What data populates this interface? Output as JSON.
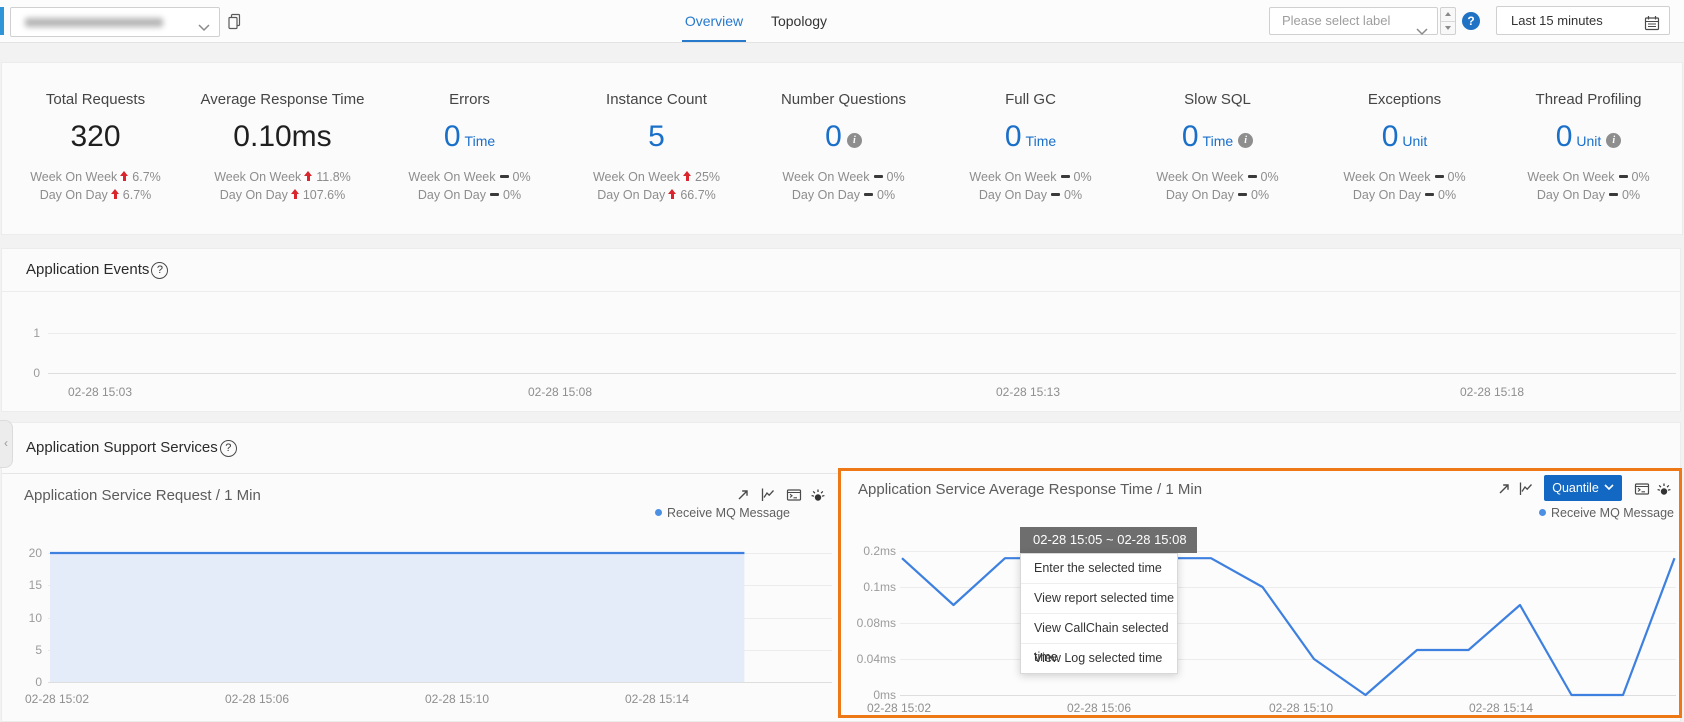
{
  "topbar": {
    "tabs": [
      {
        "label": "Overview"
      },
      {
        "label": "Topology"
      }
    ],
    "label_select_placeholder": "Please select label",
    "help_label": "?",
    "time_range": "Last 15 minutes"
  },
  "metrics": {
    "wow_label": "Week On Week",
    "dod_label": "Day On Day",
    "cards": [
      {
        "title": "Total Requests",
        "value": "320",
        "unit": "",
        "wow_trend": "up",
        "wow": "6.7%",
        "dod_trend": "up",
        "dod": "6.7%"
      },
      {
        "title": "Average Response Time",
        "value": "0.10ms",
        "unit": "",
        "wow_trend": "up",
        "wow": "11.8%",
        "dod_trend": "up",
        "dod": "107.6%"
      },
      {
        "title": "Errors",
        "value": "0",
        "unit": "Time",
        "wow_trend": "flat",
        "wow": "0%",
        "dod_trend": "flat",
        "dod": "0%"
      },
      {
        "title": "Instance Count",
        "value": "5",
        "unit": "",
        "wow_trend": "up",
        "wow": "25%",
        "dod_trend": "up",
        "dod": "66.7%"
      },
      {
        "title": "Number Questions",
        "value": "0",
        "unit": "",
        "has_info": true,
        "wow_trend": "flat",
        "wow": "0%",
        "dod_trend": "flat",
        "dod": "0%"
      },
      {
        "title": "Full GC",
        "value": "0",
        "unit": "Time",
        "wow_trend": "flat",
        "wow": "0%",
        "dod_trend": "flat",
        "dod": "0%"
      },
      {
        "title": "Slow SQL",
        "value": "0",
        "unit": "Time",
        "has_info": true,
        "wow_trend": "flat",
        "wow": "0%",
        "dod_trend": "flat",
        "dod": "0%"
      },
      {
        "title": "Exceptions",
        "value": "0",
        "unit": "Unit",
        "wow_trend": "flat",
        "wow": "0%",
        "dod_trend": "flat",
        "dod": "0%"
      },
      {
        "title": "Thread Profiling",
        "value": "0",
        "unit": "Unit",
        "has_info": true,
        "wow_trend": "flat",
        "wow": "0%",
        "dod_trend": "flat",
        "dod": "0%"
      }
    ]
  },
  "sections": {
    "events_title": "Application Events",
    "support_title": "Application Support Services"
  },
  "charts": {
    "left": {
      "title": "Application Service Request / 1 Min",
      "legend": "Receive MQ Message"
    },
    "right": {
      "title": "Application Service Average Response Time / 1 Min",
      "legend": "Receive MQ Message",
      "quantile_label": "Quantile"
    }
  },
  "context_menu": {
    "header": "02-28 15:05 ~ 02-28 15:08",
    "items": [
      "Enter the selected time",
      "View report selected time",
      "View CallChain selected time",
      "View Log selected time"
    ]
  },
  "chart_data": [
    {
      "id": "application-events",
      "type": "line",
      "title": "Application Events",
      "yticks": [
        "1",
        "0"
      ],
      "ylim": [
        0,
        1
      ],
      "xticks": [
        "02-28 15:03",
        "02-28 15:08",
        "02-28 15:13",
        "02-28 15:18"
      ],
      "grid": true,
      "series": []
    },
    {
      "id": "application-service-request",
      "type": "area",
      "title": "Application Service Request / 1 Min",
      "yticks": [
        "20",
        "15",
        "10",
        "5",
        "0"
      ],
      "ylim": [
        0,
        20
      ],
      "xticks": [
        "02-28 15:02",
        "02-28 15:06",
        "02-28 15:10",
        "02-28 15:14"
      ],
      "x_start": "02-28 15:02",
      "x_step_minutes": 1,
      "grid": true,
      "legend_position": "top-right",
      "line_color": "#3d80e0",
      "area_color": "#e4ecf9",
      "series": [
        {
          "name": "Receive MQ Message",
          "values": [
            20,
            20,
            20,
            20,
            20,
            20,
            20,
            20,
            20,
            20,
            20,
            20,
            20,
            20,
            20
          ]
        }
      ]
    },
    {
      "id": "application-service-avg-response-time",
      "type": "line",
      "title": "Application Service Average Response Time / 1 Min",
      "yticks": [
        "0.2ms",
        "0.1ms",
        "0.08ms",
        "0.04ms",
        "0ms"
      ],
      "y_axis_stops_ms": [
        0,
        0.04,
        0.08,
        0.1,
        0.2
      ],
      "xticks": [
        "02-28 15:02",
        "02-28 15:06",
        "02-28 15:10",
        "02-28 15:14"
      ],
      "x_start": "02-28 15:02",
      "x_step_minutes": 1,
      "grid": true,
      "legend_position": "top-right",
      "line_color": "#3d80e0",
      "series": [
        {
          "name": "Receive MQ Message",
          "values_ms": [
            0.18,
            0.09,
            0.18,
            0.18,
            0.18,
            0.18,
            0.18,
            0.1,
            0.04,
            0,
            0.05,
            0.05,
            0.09,
            0,
            0,
            0.18
          ]
        }
      ]
    }
  ]
}
